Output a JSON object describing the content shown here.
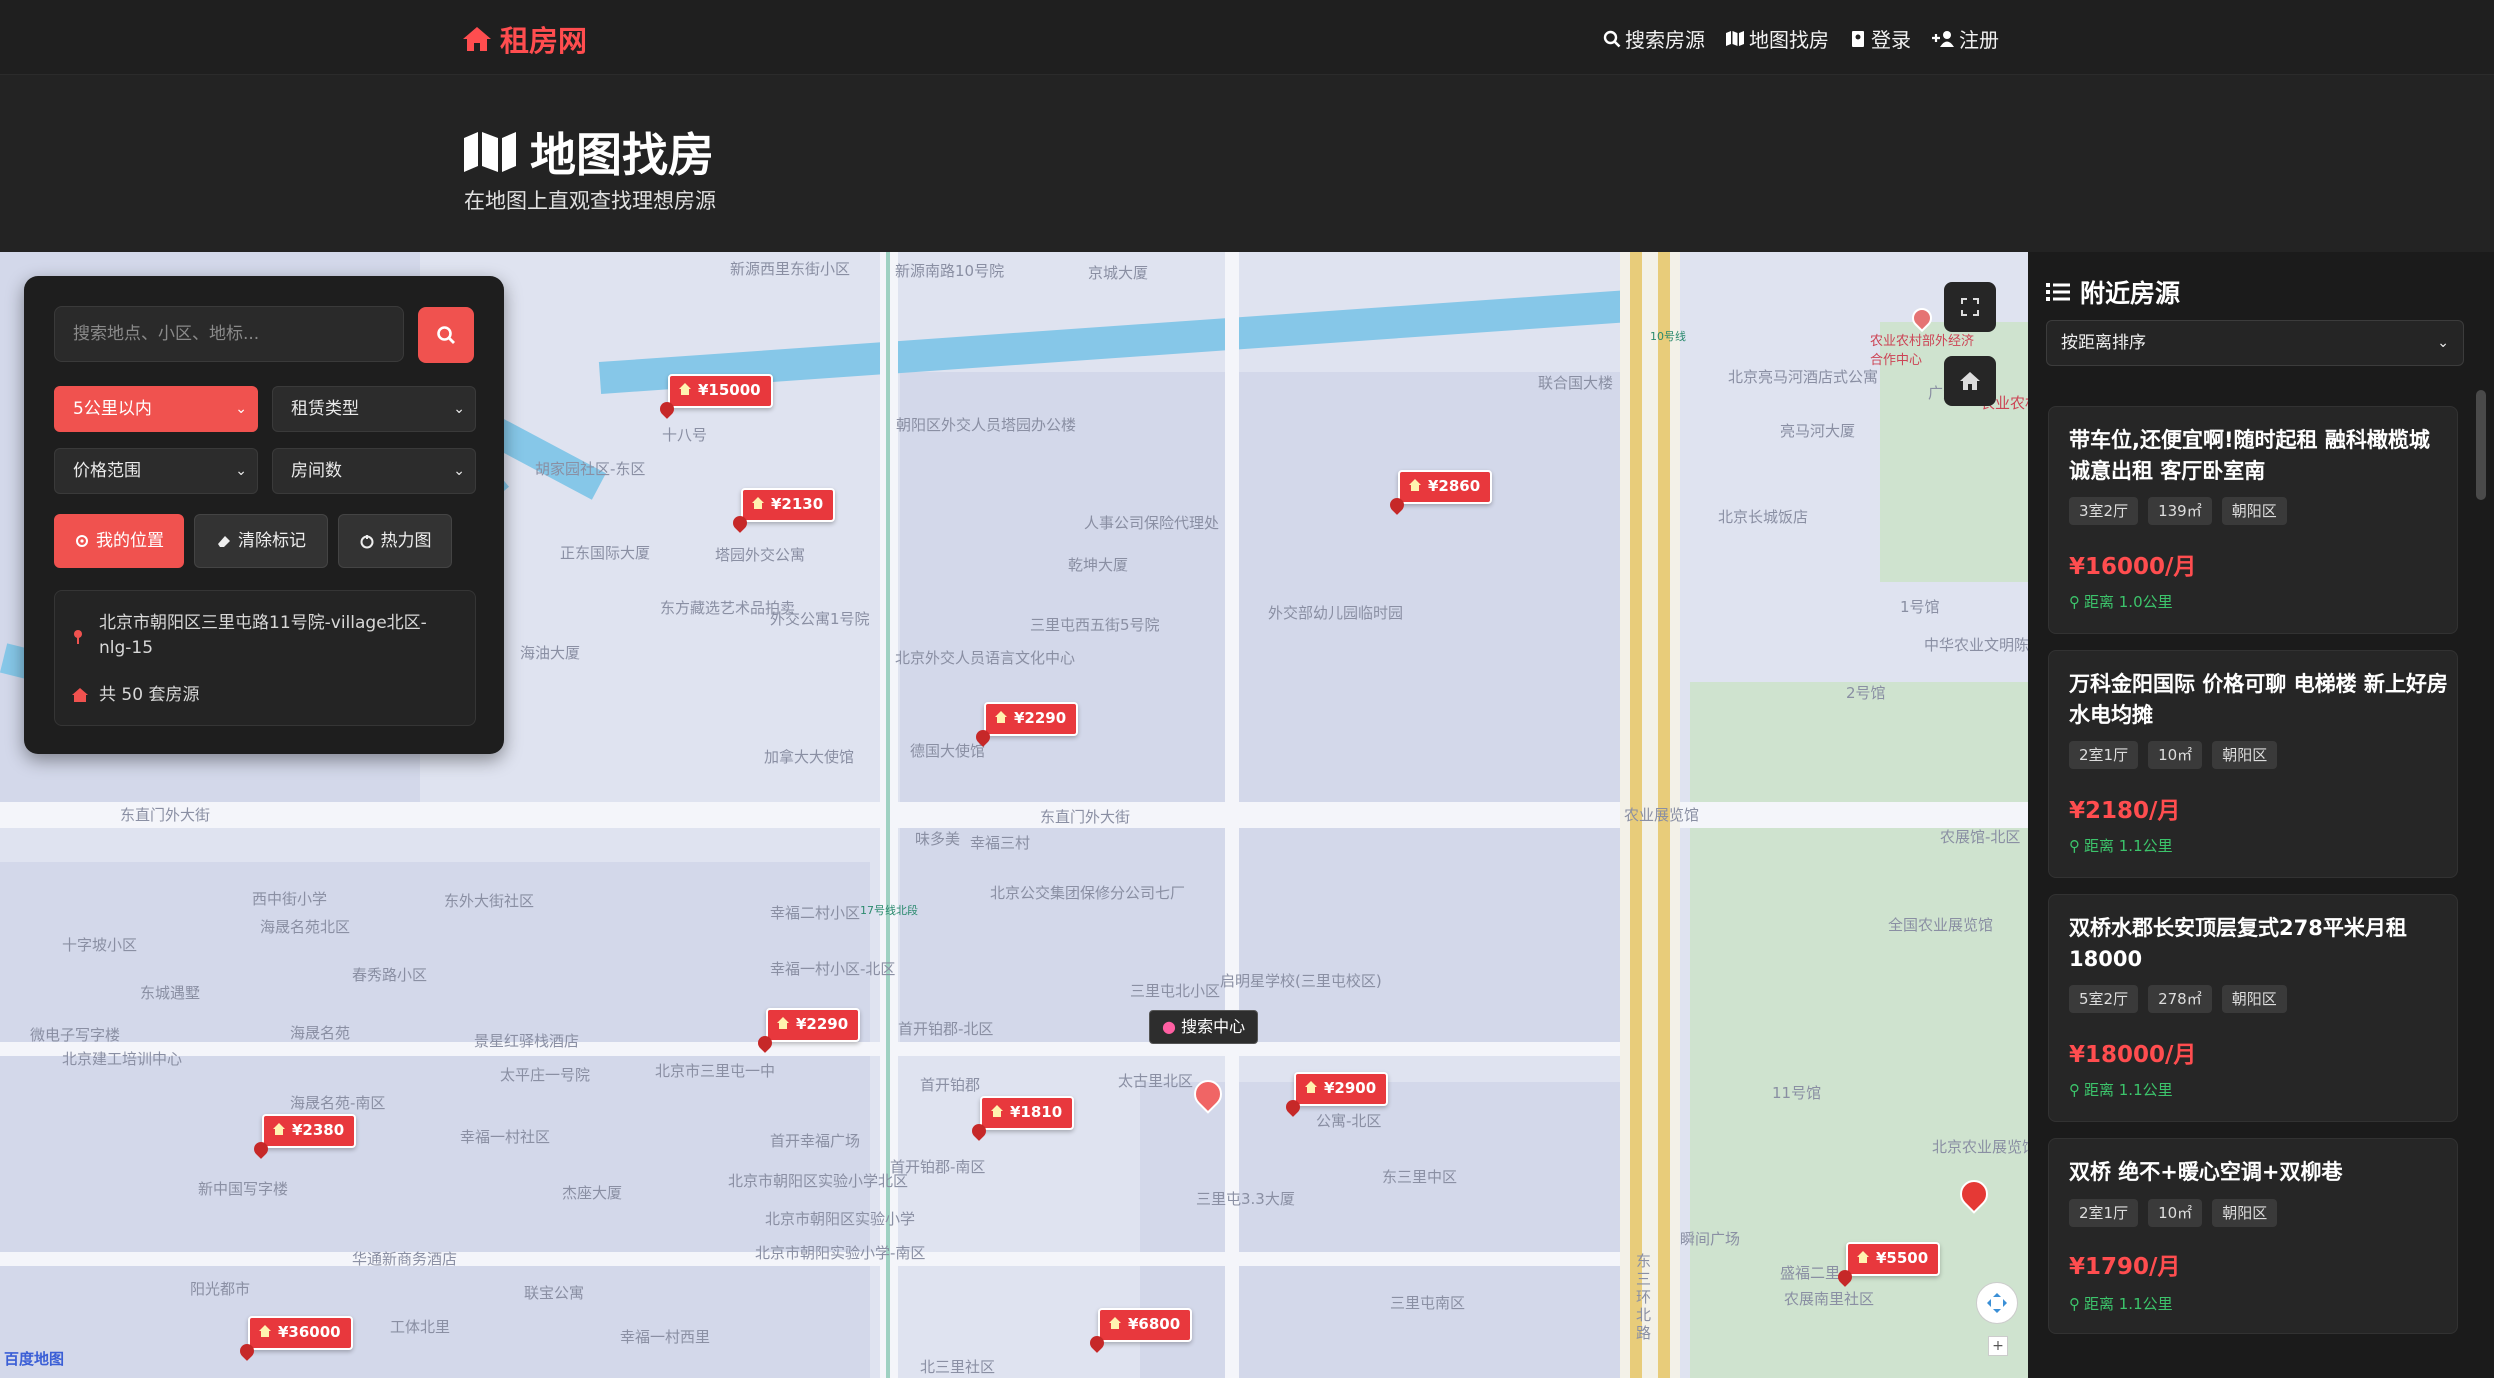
{
  "nav": {
    "brand": "租房网",
    "links": [
      {
        "label": "搜索房源",
        "icon": "search-icon"
      },
      {
        "label": "地图找房",
        "icon": "map-icon"
      },
      {
        "label": "登录",
        "icon": "user-icon"
      },
      {
        "label": "注册",
        "icon": "user-plus-icon"
      }
    ]
  },
  "hero": {
    "title": "地图找房",
    "subtitle": "在地图上直观查找理想房源"
  },
  "search_panel": {
    "placeholder": "搜索地点、小区、地标...",
    "filters": {
      "distance": "5公里以内",
      "rent_type": "租赁类型",
      "price_range": "价格范围",
      "rooms": "房间数"
    },
    "buttons": {
      "my_location": "我的位置",
      "clear_marks": "清除标记",
      "heatmap": "热力图"
    },
    "address": "北京市朝阳区三里屯路11号院-village北区-nlg-15",
    "count": "共 50 套房源"
  },
  "map": {
    "markers": [
      "¥15000",
      "¥2130",
      "¥2860",
      "¥2290",
      "¥2290",
      "¥2900",
      "¥1810",
      "¥2380",
      "¥5500",
      "¥6800",
      "¥36000"
    ],
    "center_label": "搜索中心",
    "labels": [
      "新源西里东街小区",
      "新源南路10号院",
      "京城大厦",
      "十八号",
      "朝阳区外交人员塔园办公楼",
      "胡家园社区-东区",
      "正东国际大厦",
      "塔园外交公寓",
      "东方藏选艺术品拍卖",
      "海油大厦",
      "外交公寓1号院",
      "三里屯西五街5号院",
      "北京外交人员语言文化中心",
      "外交部幼儿园临时园",
      "人事公司保险代理处",
      "乾坤大厦",
      "联合国大楼",
      "北京亮马河酒店式公寓",
      "亮马河大厦",
      "北京长城饭店",
      "东直门外大街",
      "东直门外大街",
      "加拿大大使馆",
      "德国大使馆",
      "味多美",
      "幸福三村",
      "北京公交集团保修分公司七厂",
      "幸福二村小区",
      "幸福一村小区-北区",
      "三里屯北小区",
      "启明星学校(三里屯校区)",
      "海晟名苑北区",
      "春秀路小区",
      "东城遇墅",
      "海晟名苑",
      "西中街小学",
      "东外大街社区",
      "十字坡小区",
      "微电子写字楼",
      "北京建工培训中心",
      "景星红驿栈酒店",
      "太平庄一号院",
      "首开铂郡-北区",
      "首开铂郡",
      "太古里北区",
      "北京市三里屯一中",
      "海晟名苑-南区",
      "幸福一村社区",
      "首开幸福广场",
      "首开铂郡-南区",
      "新中国写字楼",
      "杰座大厦",
      "北京市朝阳区实验小学北区",
      "北京市朝阳区实验小学",
      "北京市朝阳实验小学-南区",
      "华通新商务酒店",
      "联宝公寓",
      "阳光都市",
      "工体北里",
      "幸福一村西里",
      "北三里社区",
      "三里屯3.3大厦",
      "东三里中区",
      "三里屯南区",
      "公寓-北区",
      "农业展览馆",
      "农展馆-北区",
      "全国农业展览馆",
      "中华农业文明陈列馆",
      "1号馆",
      "2号馆",
      "11号馆",
      "北京农业展览馆",
      "农展南里社区",
      "盛福二里",
      "瞬间广场",
      "东三环北路",
      "农业农村部外经济合作中心",
      "广大厦",
      "农业农村部",
      "10号线",
      "17号线北段"
    ],
    "baidu_text": "百度地图"
  },
  "sidebar": {
    "title": "附近房源",
    "sort": "按距离排序",
    "listings": [
      {
        "title": "带车位,还便宜啊!随时起租 融科橄榄城 诚意出租 客厅卧室南",
        "layout": "3室2厅",
        "area": "139㎡",
        "district": "朝阳区",
        "price": "¥16000/月",
        "distance": "距离 1.0公里"
      },
      {
        "title": "万科金阳国际 价格可聊 电梯楼 新上好房 水电均摊",
        "layout": "2室1厅",
        "area": "10㎡",
        "district": "朝阳区",
        "price": "¥2180/月",
        "distance": "距离 1.1公里"
      },
      {
        "title": "双桥水郡长安顶层复式278平米月租18000",
        "layout": "5室2厅",
        "area": "278㎡",
        "district": "朝阳区",
        "price": "¥18000/月",
        "distance": "距离 1.1公里"
      },
      {
        "title": "双桥 绝不+暖心空调+双柳巷",
        "layout": "2室1厅",
        "area": "10㎡",
        "district": "朝阳区",
        "price": "¥1790/月",
        "distance": "距离 1.1公里"
      }
    ]
  },
  "colors": {
    "accent": "#f0524f",
    "price": "#ff4d4f",
    "distance": "#3cc46b",
    "dark_bg": "#1b1b1b"
  }
}
